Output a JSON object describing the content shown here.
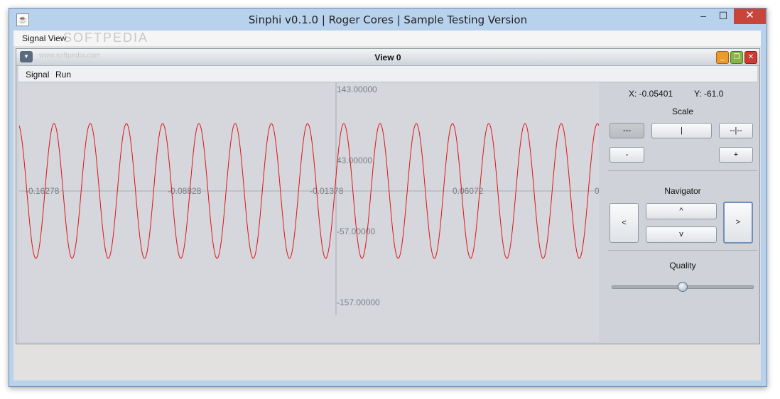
{
  "window": {
    "title": "Sinphi v0.1.0 | Roger Cores | Sample Testing Version",
    "icon": "java-icon",
    "controls": {
      "minimize": "–",
      "maximize": "☐",
      "close": "✕"
    }
  },
  "menubar": {
    "items": [
      "Signal View"
    ]
  },
  "watermark": {
    "text": "SOFTPEDIA",
    "url": "www.softpedia.com"
  },
  "internal_frame": {
    "title": "View 0",
    "menu": [
      "Signal",
      "Run"
    ]
  },
  "chart_data": {
    "type": "line",
    "x_ticks": [
      "-0.16278",
      "-0.08828",
      "-0.01378",
      "0.06072"
    ],
    "y_ticks": [
      "143.00000",
      "43.00000",
      "-57.00000",
      "-157.00000"
    ],
    "series": [
      {
        "color": "#e01414",
        "amplitude": 100,
        "cycles_visible": 16,
        "phase_at_left_edge": "peak"
      }
    ],
    "axis_color": "#a6abb2"
  },
  "panel": {
    "x_label": "X: -0.05401",
    "y_label": "Y: -61.0",
    "scale": {
      "title": "Scale",
      "buttons": [
        "---",
        "|",
        "--|--",
        "-",
        "+"
      ]
    },
    "navigator": {
      "title": "Navigator",
      "buttons": [
        "<",
        "^",
        "v",
        ">"
      ]
    },
    "quality": {
      "title": "Quality",
      "value_fraction": 0.5
    }
  }
}
